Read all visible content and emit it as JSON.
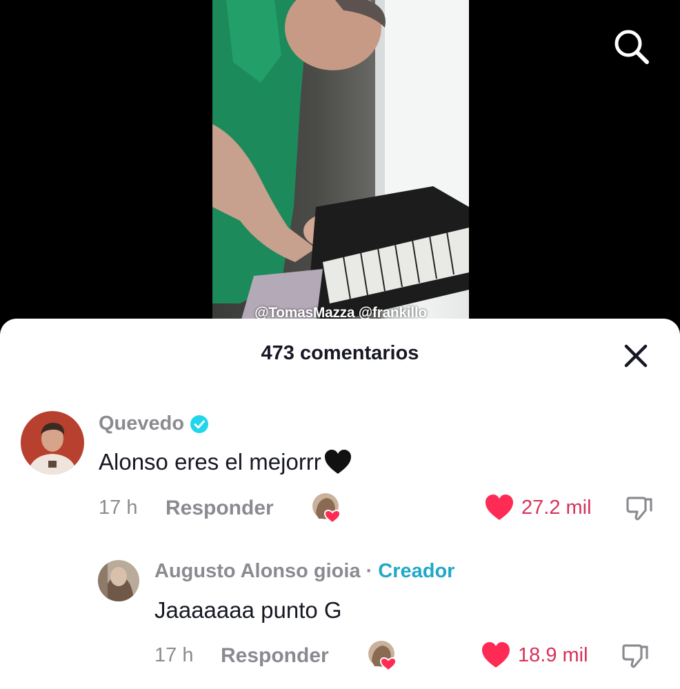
{
  "video": {
    "caption": "@TomasMazza @frankillo"
  },
  "icons": {
    "search": "search-icon",
    "close": "close-icon",
    "verified": "verified-badge-icon",
    "like": "heart-icon",
    "dislike": "thumbs-down-icon"
  },
  "comments_sheet": {
    "title": "473 comentarios",
    "comments": [
      {
        "username": "Quevedo",
        "verified": true,
        "text": "Alonso eres el mejorrr",
        "emoji": "black-heart",
        "time": "17 h",
        "reply_label": "Responder",
        "likes": "27.2 mil",
        "liked_by_creator": true
      },
      {
        "username": "Augusto Alonso gioia",
        "separator": "·",
        "badge": "Creador",
        "text": "Jaaaaaaa punto G",
        "time": "17 h",
        "reply_label": "Responder",
        "likes": "18.9 mil",
        "liked_by_creator": true
      }
    ]
  },
  "colors": {
    "like": "#fe2c55",
    "like_count": "#d8305a",
    "creator_badge": "#20a8c8",
    "verified": "#20d5ec",
    "muted_text": "#8a8b91",
    "primary_text": "#161823"
  }
}
